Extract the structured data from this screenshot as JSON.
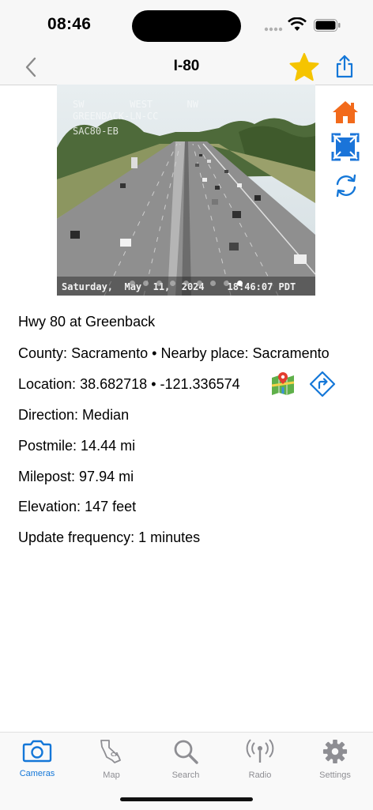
{
  "status": {
    "time": "08:46"
  },
  "nav": {
    "title": "I-80"
  },
  "camera": {
    "overlay_line1": "SW        WEST      NW",
    "overlay_line2": "GREENBACK-LN-CC",
    "overlay_line3": "SAC80-EB",
    "timestamp": "Saturday,  May  11,  2024    18:46:07 PDT",
    "page_count": 9,
    "active_page": 8
  },
  "info": {
    "title": "Hwy 80 at Greenback",
    "county_label": "County:",
    "county_value": "Sacramento",
    "nearby_label": "Nearby place:",
    "nearby_value": "Sacramento",
    "location_label": "Location:",
    "latitude": "38.682718",
    "longitude": "-121.336574",
    "direction_label": "Direction:",
    "direction_value": "Median",
    "postmile_label": "Postmile:",
    "postmile_value": "14.44 mi",
    "milepost_label": "Milepost:",
    "milepost_value": "97.94 mi",
    "elevation_label": "Elevation:",
    "elevation_value": "147 feet",
    "update_label": "Update frequency:",
    "update_value": "1 minutes",
    "separator": "•"
  },
  "tabs": [
    {
      "label": "Cameras",
      "icon": "camera-icon",
      "active": true
    },
    {
      "label": "Map",
      "icon": "california-map-icon",
      "active": false
    },
    {
      "label": "Search",
      "icon": "magnifier-icon",
      "active": false
    },
    {
      "label": "Radio",
      "icon": "antenna-icon",
      "active": false
    },
    {
      "label": "Settings",
      "icon": "gear-icon",
      "active": false
    }
  ],
  "colors": {
    "accent": "#1477d8",
    "star": "#f5c400",
    "home": "#f26a1b",
    "inactive": "#8e8e93"
  }
}
